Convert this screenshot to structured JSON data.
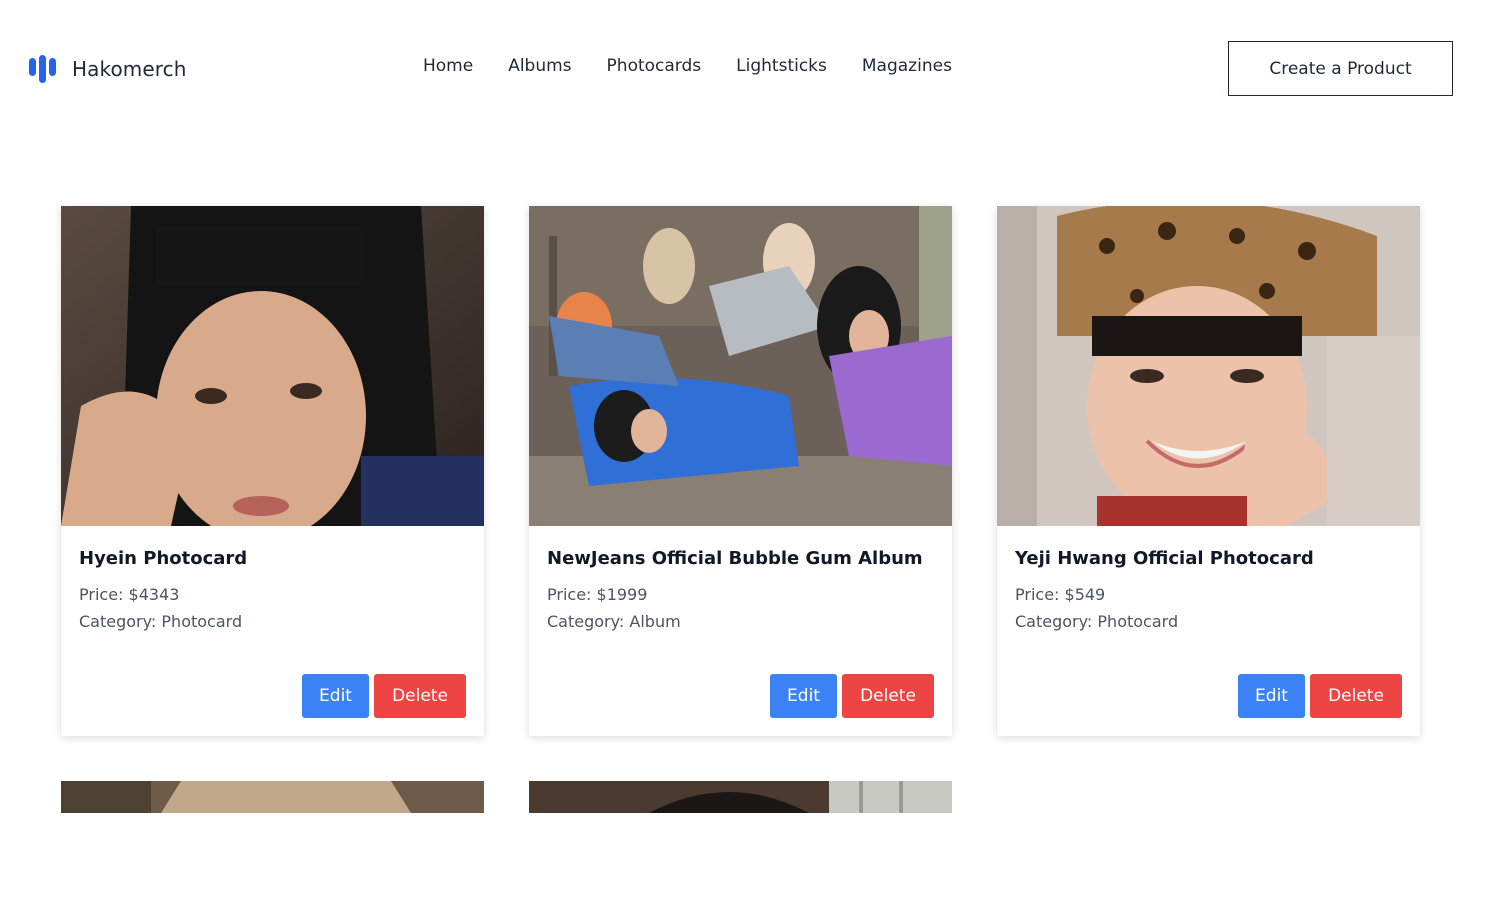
{
  "brand": {
    "name": "Hakomerch",
    "logo_icon": "bar-logo-icon",
    "accent": "#2563eb"
  },
  "nav": {
    "links": [
      {
        "label": "Home"
      },
      {
        "label": "Albums"
      },
      {
        "label": "Photocards"
      },
      {
        "label": "Lightsticks"
      },
      {
        "label": "Magazines"
      }
    ],
    "create_label": "Create a Product"
  },
  "products": [
    {
      "title": "Hyein Photocard",
      "price": "Price: $4343",
      "category": "Category: Photocard",
      "edit_label": "Edit",
      "delete_label": "Delete"
    },
    {
      "title": "NewJeans Official Bubble Gum Album",
      "price": "Price: $1999",
      "category": "Category: Album",
      "edit_label": "Edit",
      "delete_label": "Delete"
    },
    {
      "title": "Yeji Hwang Official Photocard",
      "price": "Price: $549",
      "category": "Category: Photocard",
      "edit_label": "Edit",
      "delete_label": "Delete"
    }
  ],
  "colors": {
    "edit": "#3b82f6",
    "delete": "#ef4444",
    "text": "#1f2937"
  }
}
